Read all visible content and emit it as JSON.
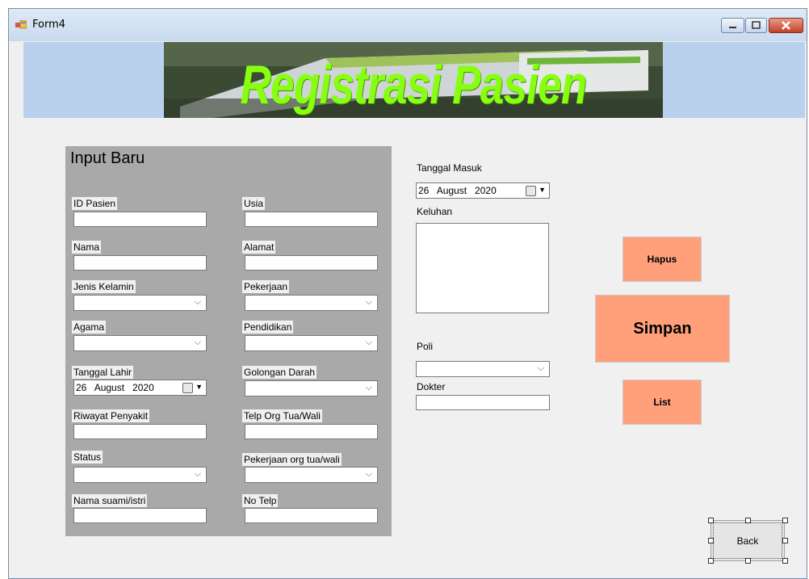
{
  "window": {
    "title": "Form4"
  },
  "banner": {
    "title": "Registrasi Pasien"
  },
  "panel": {
    "title": "Input Baru",
    "fields": {
      "id_pasien": "ID Pasien",
      "usia": "Usia",
      "nama": "Nama",
      "alamat": "Alamat",
      "jenis_kelamin": "Jenis Kelamin",
      "pekerjaan": "Pekerjaan",
      "agama": "Agama",
      "pendidikan": "Pendidikan",
      "tanggal_lahir": "Tanggal Lahir",
      "golongan_darah": "Golongan Darah",
      "riwayat_penyakit": "Riwayat Penyakit",
      "telp_ortu": "Telp Org Tua/Wali",
      "status": "Status",
      "pekerjaan_ortu": "Pekerjaan org tua/wali",
      "nama_suami_istri": "Nama suami/istri",
      "no_telp": "No Telp"
    },
    "tanggal_lahir_value": "26   August   2020"
  },
  "right": {
    "tanggal_masuk_label": "Tanggal Masuk",
    "tanggal_masuk_value": "26   August   2020",
    "keluhan_label": "Keluhan",
    "poli_label": "Poli",
    "dokter_label": "Dokter"
  },
  "buttons": {
    "hapus": "Hapus",
    "simpan": "Simpan",
    "list": "List",
    "back": "Back"
  },
  "colors": {
    "accent_button": "#ffa07a",
    "banner_text": "#86ff12",
    "panel_bg": "#a9a9a9"
  }
}
